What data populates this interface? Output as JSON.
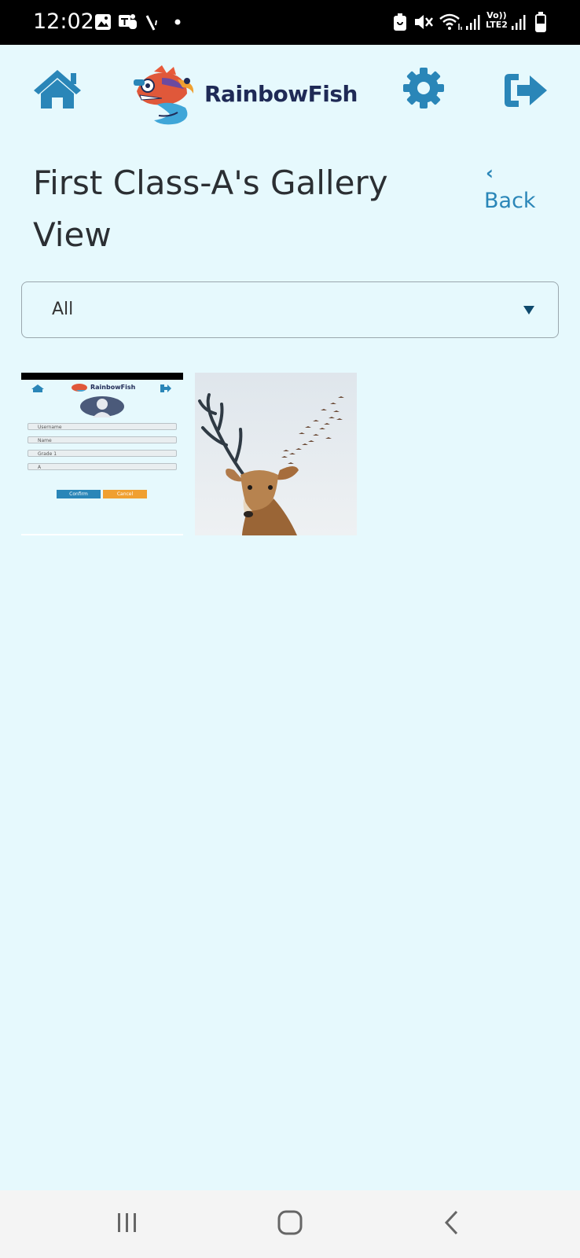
{
  "status_bar": {
    "time": "12:02",
    "carrier_label_top": "Vo))",
    "carrier_label_bottom": "LTE2",
    "icons": [
      "gallery-icon",
      "teams-icon",
      "signal-check-icon",
      "dot-icon",
      "battery-saver-icon",
      "mute-icon",
      "wifi-icon",
      "signal-icon",
      "signal-icon-2",
      "battery-icon"
    ]
  },
  "header": {
    "brand": "RainbowFish",
    "icons": [
      "home-icon",
      "rainbowfish-logo",
      "settings-icon",
      "logout-icon"
    ]
  },
  "page": {
    "title": "First Class-A's Gallery View",
    "back_label": "Back"
  },
  "filter": {
    "selected": "All"
  },
  "gallery": {
    "items": [
      {
        "type": "screenshot",
        "mini_brand": "RainbowFish",
        "mini_field_1": "Username",
        "mini_field_2": "Name",
        "mini_field_3": "Grade 1",
        "mini_field_4": "A",
        "mini_confirm": "Confirm",
        "mini_cancel": "Cancel"
      },
      {
        "type": "painting",
        "subject": "deer"
      }
    ]
  },
  "colors": {
    "background": "#e6f9fd",
    "accent": "#2a86b8",
    "title": "#2b2f33",
    "brand_text": "#1f2a56"
  }
}
